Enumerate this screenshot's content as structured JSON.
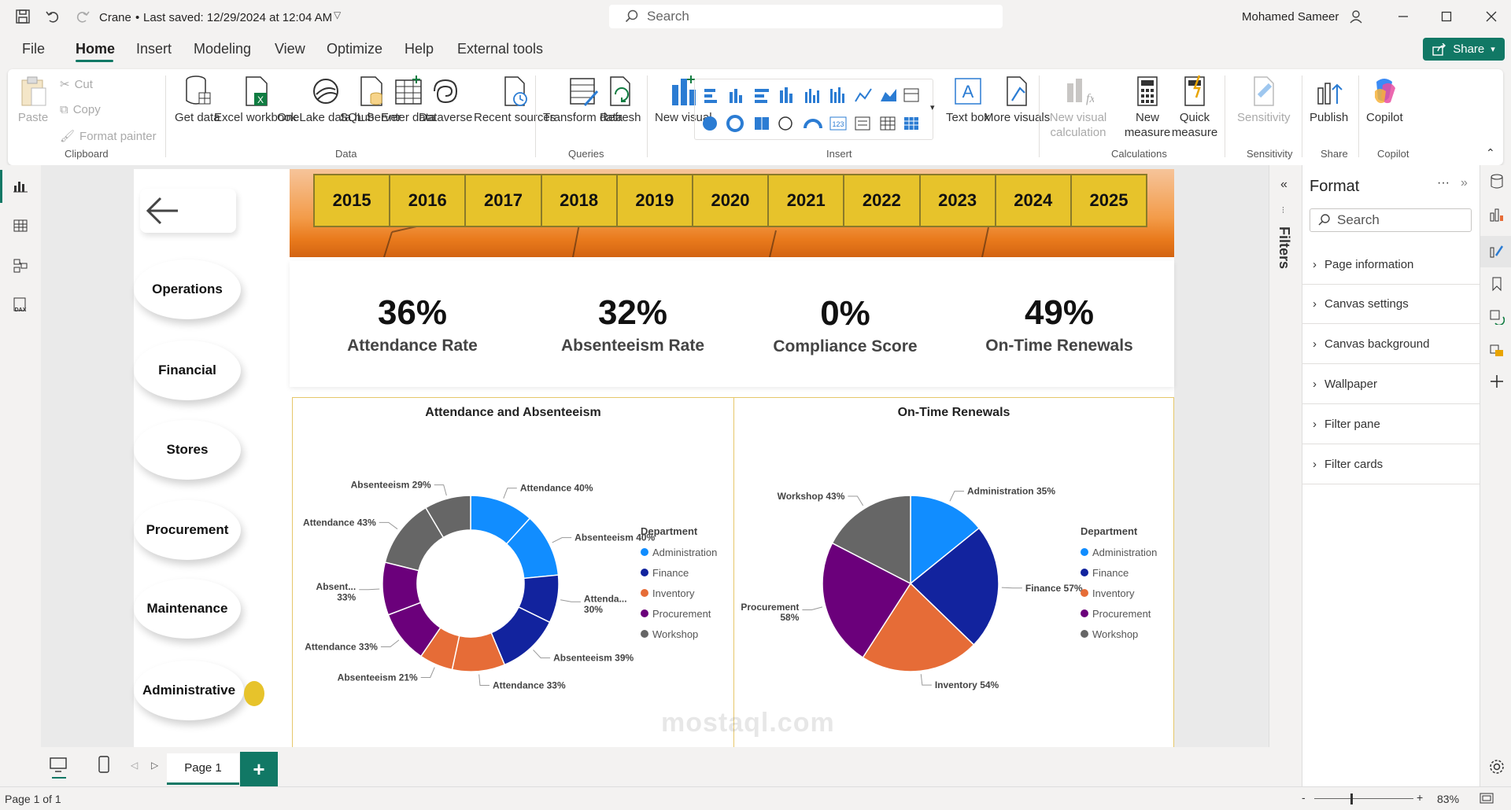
{
  "titlebar": {
    "title": "Crane",
    "last_saved": "Last saved: 12/29/2024 at 12:04 AM",
    "search_placeholder": "Search",
    "user": "Mohamed Sameer"
  },
  "menu": {
    "items": [
      "File",
      "Home",
      "Insert",
      "Modeling",
      "View",
      "Optimize",
      "Help",
      "External tools"
    ],
    "share": "Share"
  },
  "ribbon": {
    "clipboard": {
      "paste": "Paste",
      "cut": "Cut",
      "copy": "Copy",
      "format_painter": "Format painter",
      "group": "Clipboard"
    },
    "data": {
      "get_data": "Get data",
      "excel": "Excel workbook",
      "onelake": "OneLake data hub",
      "sql": "SQL Server",
      "enter": "Enter data",
      "dataverse": "Dataverse",
      "recent": "Recent sources",
      "group": "Data"
    },
    "queries": {
      "transform": "Transform data",
      "refresh": "Refresh",
      "group": "Queries"
    },
    "insert": {
      "new_visual": "New visual",
      "text_box": "Text box",
      "more_visuals": "More visuals",
      "group": "Insert"
    },
    "calculations": {
      "new_visual_calc": "New visual calculation",
      "new_measure": "New measure",
      "quick_measure": "Quick measure",
      "group": "Calculations"
    },
    "sensitivity": {
      "label": "Sensitivity",
      "group": "Sensitivity"
    },
    "share": {
      "publish": "Publish",
      "group": "Share"
    },
    "copilot": {
      "label": "Copilot",
      "group": "Copilot"
    }
  },
  "nav": {
    "items": [
      "Operations",
      "Financial",
      "Stores",
      "Procurement",
      "Maintenance",
      "Administrative"
    ]
  },
  "years": [
    "2015",
    "2016",
    "2017",
    "2018",
    "2019",
    "2020",
    "2021",
    "2022",
    "2023",
    "2024",
    "2025"
  ],
  "kpis": [
    {
      "value": "36%",
      "label": "Attendance Rate"
    },
    {
      "value": "32%",
      "label": "Absenteeism Rate"
    },
    {
      "value": "0%",
      "label": "Compliance Score"
    },
    {
      "value": "49%",
      "label": "On-Time Renewals"
    }
  ],
  "chart_data": [
    {
      "type": "pie",
      "variant": "donut",
      "title": "Attendance and Absenteeism",
      "legend_title": "Department",
      "legend": [
        "Administration",
        "Finance",
        "Inventory",
        "Procurement",
        "Workshop"
      ],
      "colors": {
        "Administration": "#118dff",
        "Finance": "#12239e",
        "Inventory": "#e66c37",
        "Procurement": "#6b007b",
        "Workshop": "#666666"
      },
      "slices": [
        {
          "department": "Administration",
          "label": "Attendance 40%",
          "value": 40
        },
        {
          "department": "Administration",
          "label": "Absenteeism 40%",
          "value": 40
        },
        {
          "department": "Finance",
          "label": "Attenda... 30%",
          "value": 30
        },
        {
          "department": "Finance",
          "label": "Absenteeism 39%",
          "value": 39
        },
        {
          "department": "Inventory",
          "label": "Attendance 33%",
          "value": 33
        },
        {
          "department": "Inventory",
          "label": "Absenteeism 21%",
          "value": 21
        },
        {
          "department": "Procurement",
          "label": "Attendance 33%",
          "value": 33
        },
        {
          "department": "Procurement",
          "label": "Absent... 33%",
          "value": 33
        },
        {
          "department": "Workshop",
          "label": "Attendance 43%",
          "value": 43
        },
        {
          "department": "Workshop",
          "label": "Absenteeism 29%",
          "value": 29
        }
      ]
    },
    {
      "type": "pie",
      "title": "On-Time Renewals",
      "legend_title": "Department",
      "legend": [
        "Administration",
        "Finance",
        "Inventory",
        "Procurement",
        "Workshop"
      ],
      "colors": {
        "Administration": "#118dff",
        "Finance": "#12239e",
        "Inventory": "#e66c37",
        "Procurement": "#6b007b",
        "Workshop": "#666666"
      },
      "slices": [
        {
          "department": "Administration",
          "label": "Administration 35%",
          "value": 35
        },
        {
          "department": "Finance",
          "label": "Finance 57%",
          "value": 57
        },
        {
          "department": "Inventory",
          "label": "Inventory 54%",
          "value": 54
        },
        {
          "department": "Procurement",
          "label": "Procurement 58%",
          "value": 58
        },
        {
          "department": "Workshop",
          "label": "Workshop 43%",
          "value": 43
        }
      ]
    }
  ],
  "filters_label": "Filters",
  "format_pane": {
    "title": "Format",
    "search_placeholder": "Search",
    "items": [
      "Page information",
      "Canvas settings",
      "Canvas background",
      "Wallpaper",
      "Filter pane",
      "Filter cards"
    ]
  },
  "pages": {
    "tab": "Page 1",
    "add": "+"
  },
  "status": {
    "page": "Page 1 of 1",
    "zoom": "83%"
  },
  "watermark": "mostaql.com"
}
